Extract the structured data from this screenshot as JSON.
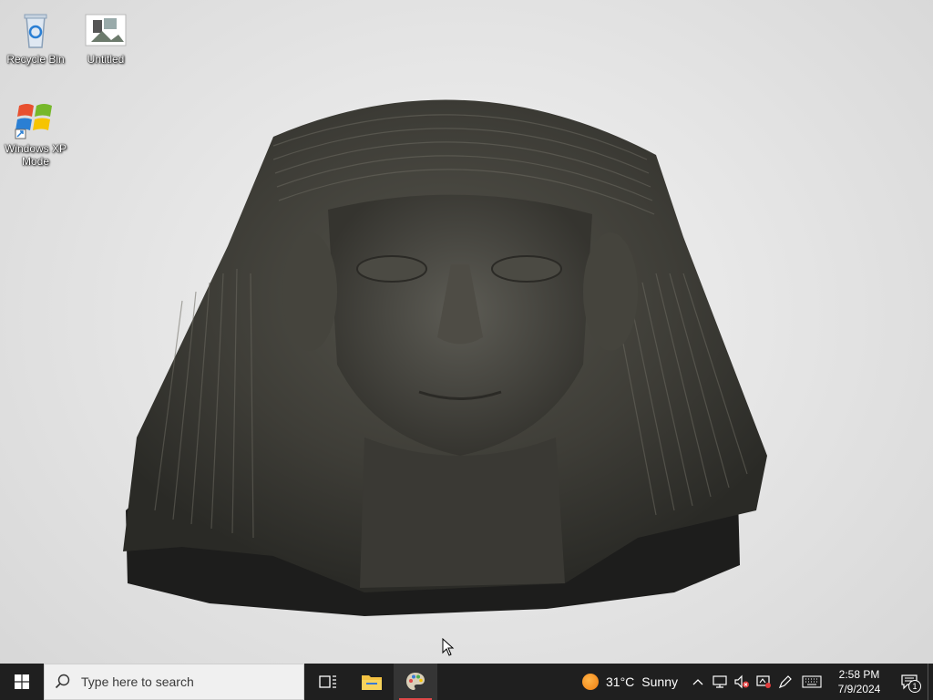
{
  "desktop": {
    "icons": [
      {
        "label": "Recycle Bin",
        "icon": "recycle-bin-icon"
      },
      {
        "label": "Untitled",
        "icon": "image-file-icon"
      },
      {
        "label": "Windows XP Mode",
        "icon": "windows-xp-icon"
      }
    ],
    "wallpaper": "Egyptian stone head sculpture"
  },
  "taskbar": {
    "search_placeholder": "Type here to search",
    "pinned": [
      {
        "name": "Task View",
        "icon": "task-view-icon"
      },
      {
        "name": "File Explorer",
        "icon": "folder-icon"
      },
      {
        "name": "Paint",
        "icon": "paint-icon",
        "active": true
      }
    ],
    "weather": {
      "temp": "31°C",
      "condition": "Sunny"
    },
    "clock": {
      "time": "2:58 PM",
      "date": "7/9/2024"
    },
    "notifications": {
      "count": "1"
    }
  },
  "colors": {
    "taskbar_bg": "#1f1f1f",
    "active_indicator": "#e04848"
  }
}
